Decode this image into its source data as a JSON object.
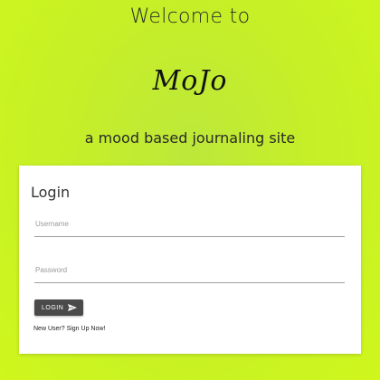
{
  "header": {
    "welcome": "Welcome to",
    "brand": "MoJo",
    "tagline": "a mood based journaling site"
  },
  "login_card": {
    "title": "Login",
    "username_placeholder": "Username",
    "password_placeholder": "Password",
    "login_button_label": "LOGIN",
    "login_button_icon": "send-icon",
    "signup_link": "New User? Sign Up Now!"
  },
  "colors": {
    "background": "#c6ef28",
    "card": "#ffffff",
    "button": "#4a4a4a"
  }
}
